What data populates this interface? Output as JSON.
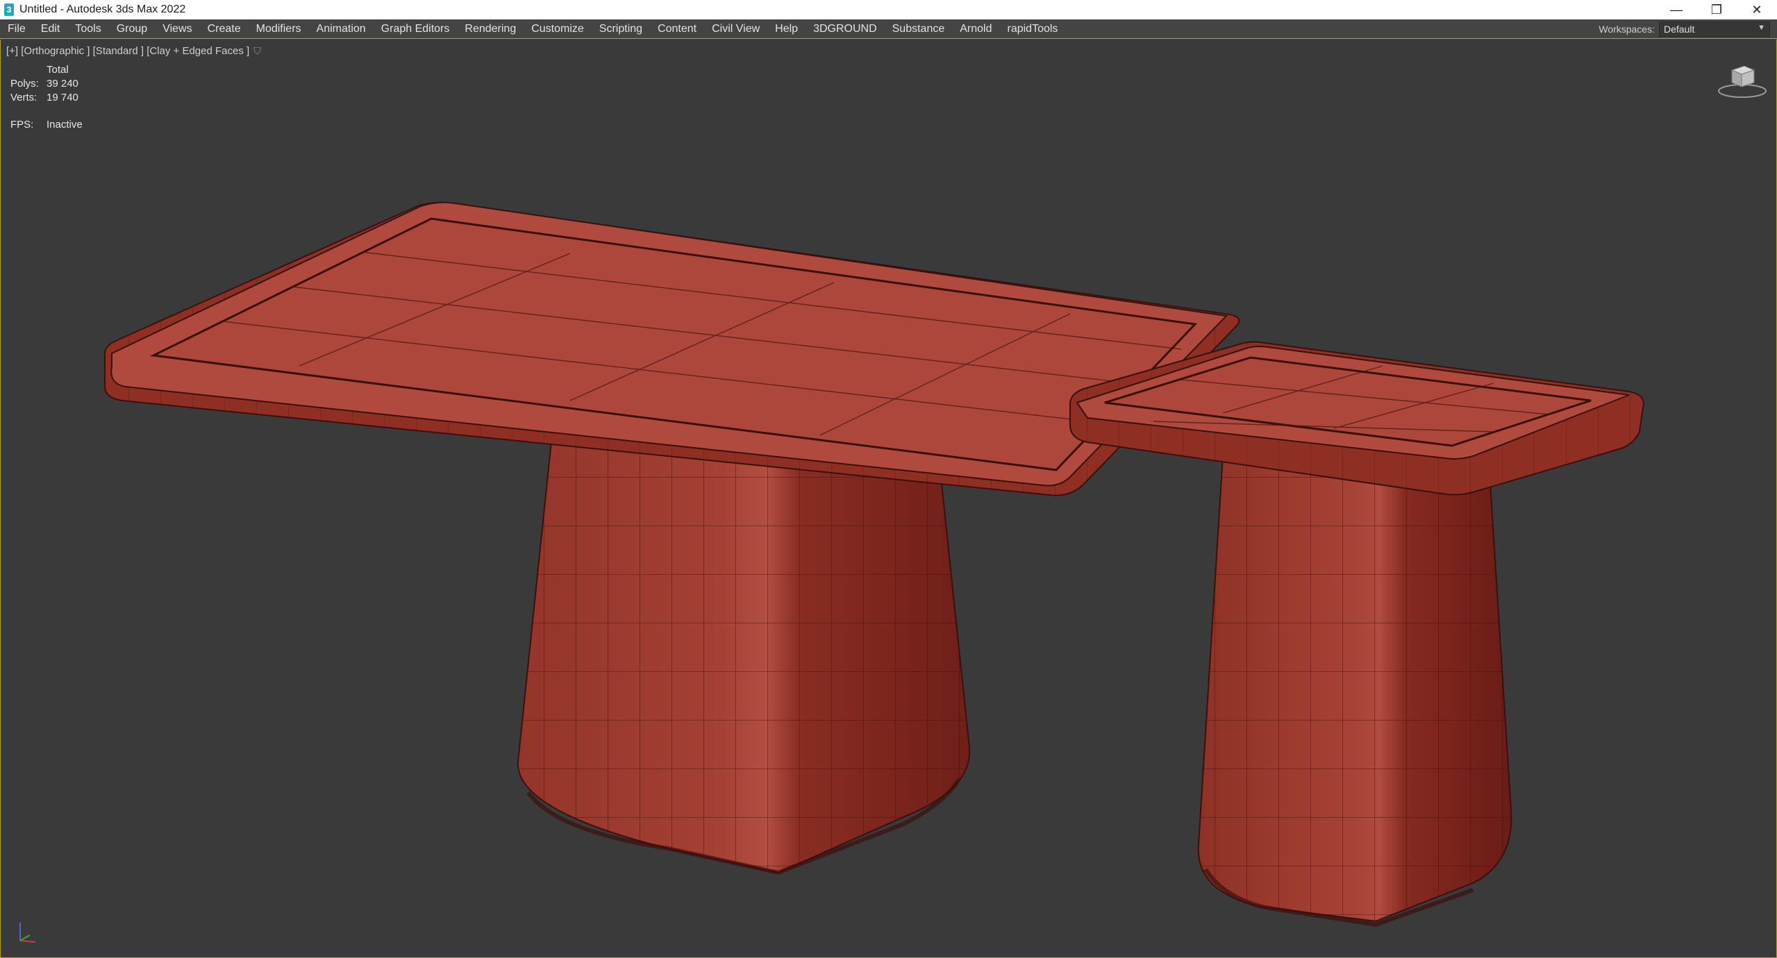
{
  "window": {
    "app_icon_glyph": "3",
    "title": "Untitled - Autodesk 3ds Max 2022",
    "minimize_glyph": "—",
    "restore_glyph": "❐",
    "close_glyph": "✕"
  },
  "menu": {
    "items": [
      "File",
      "Edit",
      "Tools",
      "Group",
      "Views",
      "Create",
      "Modifiers",
      "Animation",
      "Graph Editors",
      "Rendering",
      "Customize",
      "Scripting",
      "Content",
      "Civil View",
      "Help",
      "3DGROUND",
      "Substance",
      "Arnold",
      "rapidTools"
    ],
    "workspaces_label": "Workspaces:",
    "workspace_value": "Default"
  },
  "viewport": {
    "label": "[+] [Orthographic ] [Standard ] [Clay + Edged Faces ]",
    "stats": {
      "header": "Total",
      "polys_label": "Polys:",
      "polys_value": "39 240",
      "verts_label": "Verts:",
      "verts_value": "19 740",
      "fps_label": "FPS:",
      "fps_value": "Inactive"
    }
  },
  "colors": {
    "clay_top": "#b14a3e",
    "clay_side": "#8f2f24",
    "clay_dark": "#6e1f18",
    "background": "#3a3a3a",
    "accent_border": "#b8a020"
  },
  "icons": [
    "app-icon",
    "filter-icon",
    "viewcube-icon",
    "axis-tripod-icon"
  ]
}
